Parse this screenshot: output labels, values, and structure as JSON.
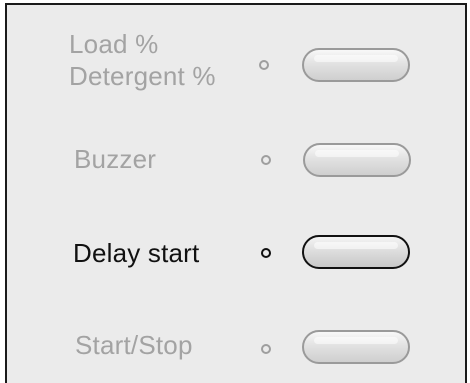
{
  "panel": {
    "rows": [
      {
        "label_line1": "Load %",
        "label_line2": "Detergent %",
        "state": "inactive"
      },
      {
        "label": "Buzzer",
        "state": "inactive"
      },
      {
        "label": "Delay start",
        "state": "active"
      },
      {
        "label": "Start/Stop",
        "state": "inactive"
      }
    ]
  },
  "colors": {
    "panel_background": "#ebebeb",
    "inactive_text": "#a3a3a3",
    "active_text": "#111111",
    "frame": "#1a1a1a"
  },
  "icons": {
    "indicator": "indicator-light-icon",
    "button": "pill-button"
  }
}
